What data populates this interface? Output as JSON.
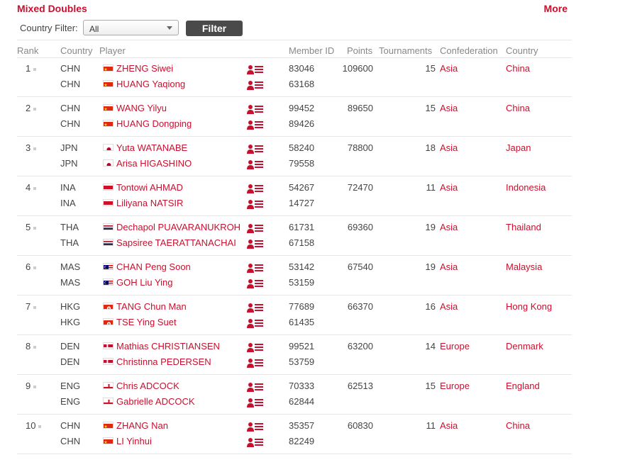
{
  "title": "Mixed Doubles",
  "more": "More",
  "filter": {
    "label": "Country Filter:",
    "selected": "All",
    "button": "Filter"
  },
  "headers": {
    "rank": "Rank",
    "country": "Country",
    "player": "Player",
    "member_id": "Member ID",
    "points": "Points",
    "tournaments": "Tournaments",
    "confederation": "Confederation",
    "country_name": "Country"
  },
  "colors": {
    "accent": "#c8102e"
  },
  "rows": [
    {
      "rank": "1",
      "points": "109600",
      "tournaments": "15",
      "confederation": "Asia",
      "country_name": "China",
      "players": [
        {
          "code": "CHN",
          "flag": "china",
          "name": "ZHENG Siwei",
          "member_id": "83046"
        },
        {
          "code": "CHN",
          "flag": "china",
          "name": "HUANG Yaqiong",
          "member_id": "63168"
        }
      ]
    },
    {
      "rank": "2",
      "points": "89650",
      "tournaments": "15",
      "confederation": "Asia",
      "country_name": "China",
      "players": [
        {
          "code": "CHN",
          "flag": "china",
          "name": "WANG Yilyu",
          "member_id": "99452"
        },
        {
          "code": "CHN",
          "flag": "china",
          "name": "HUANG Dongping",
          "member_id": "89426"
        }
      ]
    },
    {
      "rank": "3",
      "points": "78800",
      "tournaments": "18",
      "confederation": "Asia",
      "country_name": "Japan",
      "players": [
        {
          "code": "JPN",
          "flag": "japan",
          "name": "Yuta WATANABE",
          "member_id": "58240"
        },
        {
          "code": "JPN",
          "flag": "japan",
          "name": "Arisa HIGASHINO",
          "member_id": "79558"
        }
      ]
    },
    {
      "rank": "4",
      "points": "72470",
      "tournaments": "11",
      "confederation": "Asia",
      "country_name": "Indonesia",
      "players": [
        {
          "code": "INA",
          "flag": "indonesia",
          "name": "Tontowi AHMAD",
          "member_id": "54267"
        },
        {
          "code": "INA",
          "flag": "indonesia",
          "name": "Liliyana NATSIR",
          "member_id": "14727"
        }
      ]
    },
    {
      "rank": "5",
      "points": "69360",
      "tournaments": "19",
      "confederation": "Asia",
      "country_name": "Thailand",
      "players": [
        {
          "code": "THA",
          "flag": "thailand",
          "name": "Dechapol PUAVARANUKROH",
          "member_id": "61731"
        },
        {
          "code": "THA",
          "flag": "thailand",
          "name": "Sapsiree TAERATTANACHAI",
          "member_id": "67158"
        }
      ]
    },
    {
      "rank": "6",
      "points": "67540",
      "tournaments": "19",
      "confederation": "Asia",
      "country_name": "Malaysia",
      "players": [
        {
          "code": "MAS",
          "flag": "malaysia",
          "name": "CHAN Peng Soon",
          "member_id": "53142"
        },
        {
          "code": "MAS",
          "flag": "malaysia",
          "name": "GOH Liu Ying",
          "member_id": "53159"
        }
      ]
    },
    {
      "rank": "7",
      "points": "66370",
      "tournaments": "16",
      "confederation": "Asia",
      "country_name": "Hong Kong",
      "players": [
        {
          "code": "HKG",
          "flag": "hongkong",
          "name": "TANG Chun Man",
          "member_id": "77689"
        },
        {
          "code": "HKG",
          "flag": "hongkong",
          "name": "TSE Ying Suet",
          "member_id": "61435"
        }
      ]
    },
    {
      "rank": "8",
      "points": "63200",
      "tournaments": "14",
      "confederation": "Europe",
      "country_name": "Denmark",
      "players": [
        {
          "code": "DEN",
          "flag": "denmark",
          "name": "Mathias CHRISTIANSEN",
          "member_id": "99521"
        },
        {
          "code": "DEN",
          "flag": "denmark",
          "name": "Christinna PEDERSEN",
          "member_id": "53759"
        }
      ]
    },
    {
      "rank": "9",
      "points": "62513",
      "tournaments": "15",
      "confederation": "Europe",
      "country_name": "England",
      "players": [
        {
          "code": "ENG",
          "flag": "england",
          "name": "Chris ADCOCK",
          "member_id": "70333"
        },
        {
          "code": "ENG",
          "flag": "england",
          "name": "Gabrielle ADCOCK",
          "member_id": "62844"
        }
      ]
    },
    {
      "rank": "10",
      "points": "60830",
      "tournaments": "11",
      "confederation": "Asia",
      "country_name": "China",
      "players": [
        {
          "code": "CHN",
          "flag": "china",
          "name": "ZHANG Nan",
          "member_id": "35357"
        },
        {
          "code": "CHN",
          "flag": "china",
          "name": "LI Yinhui",
          "member_id": "82249"
        }
      ]
    }
  ]
}
